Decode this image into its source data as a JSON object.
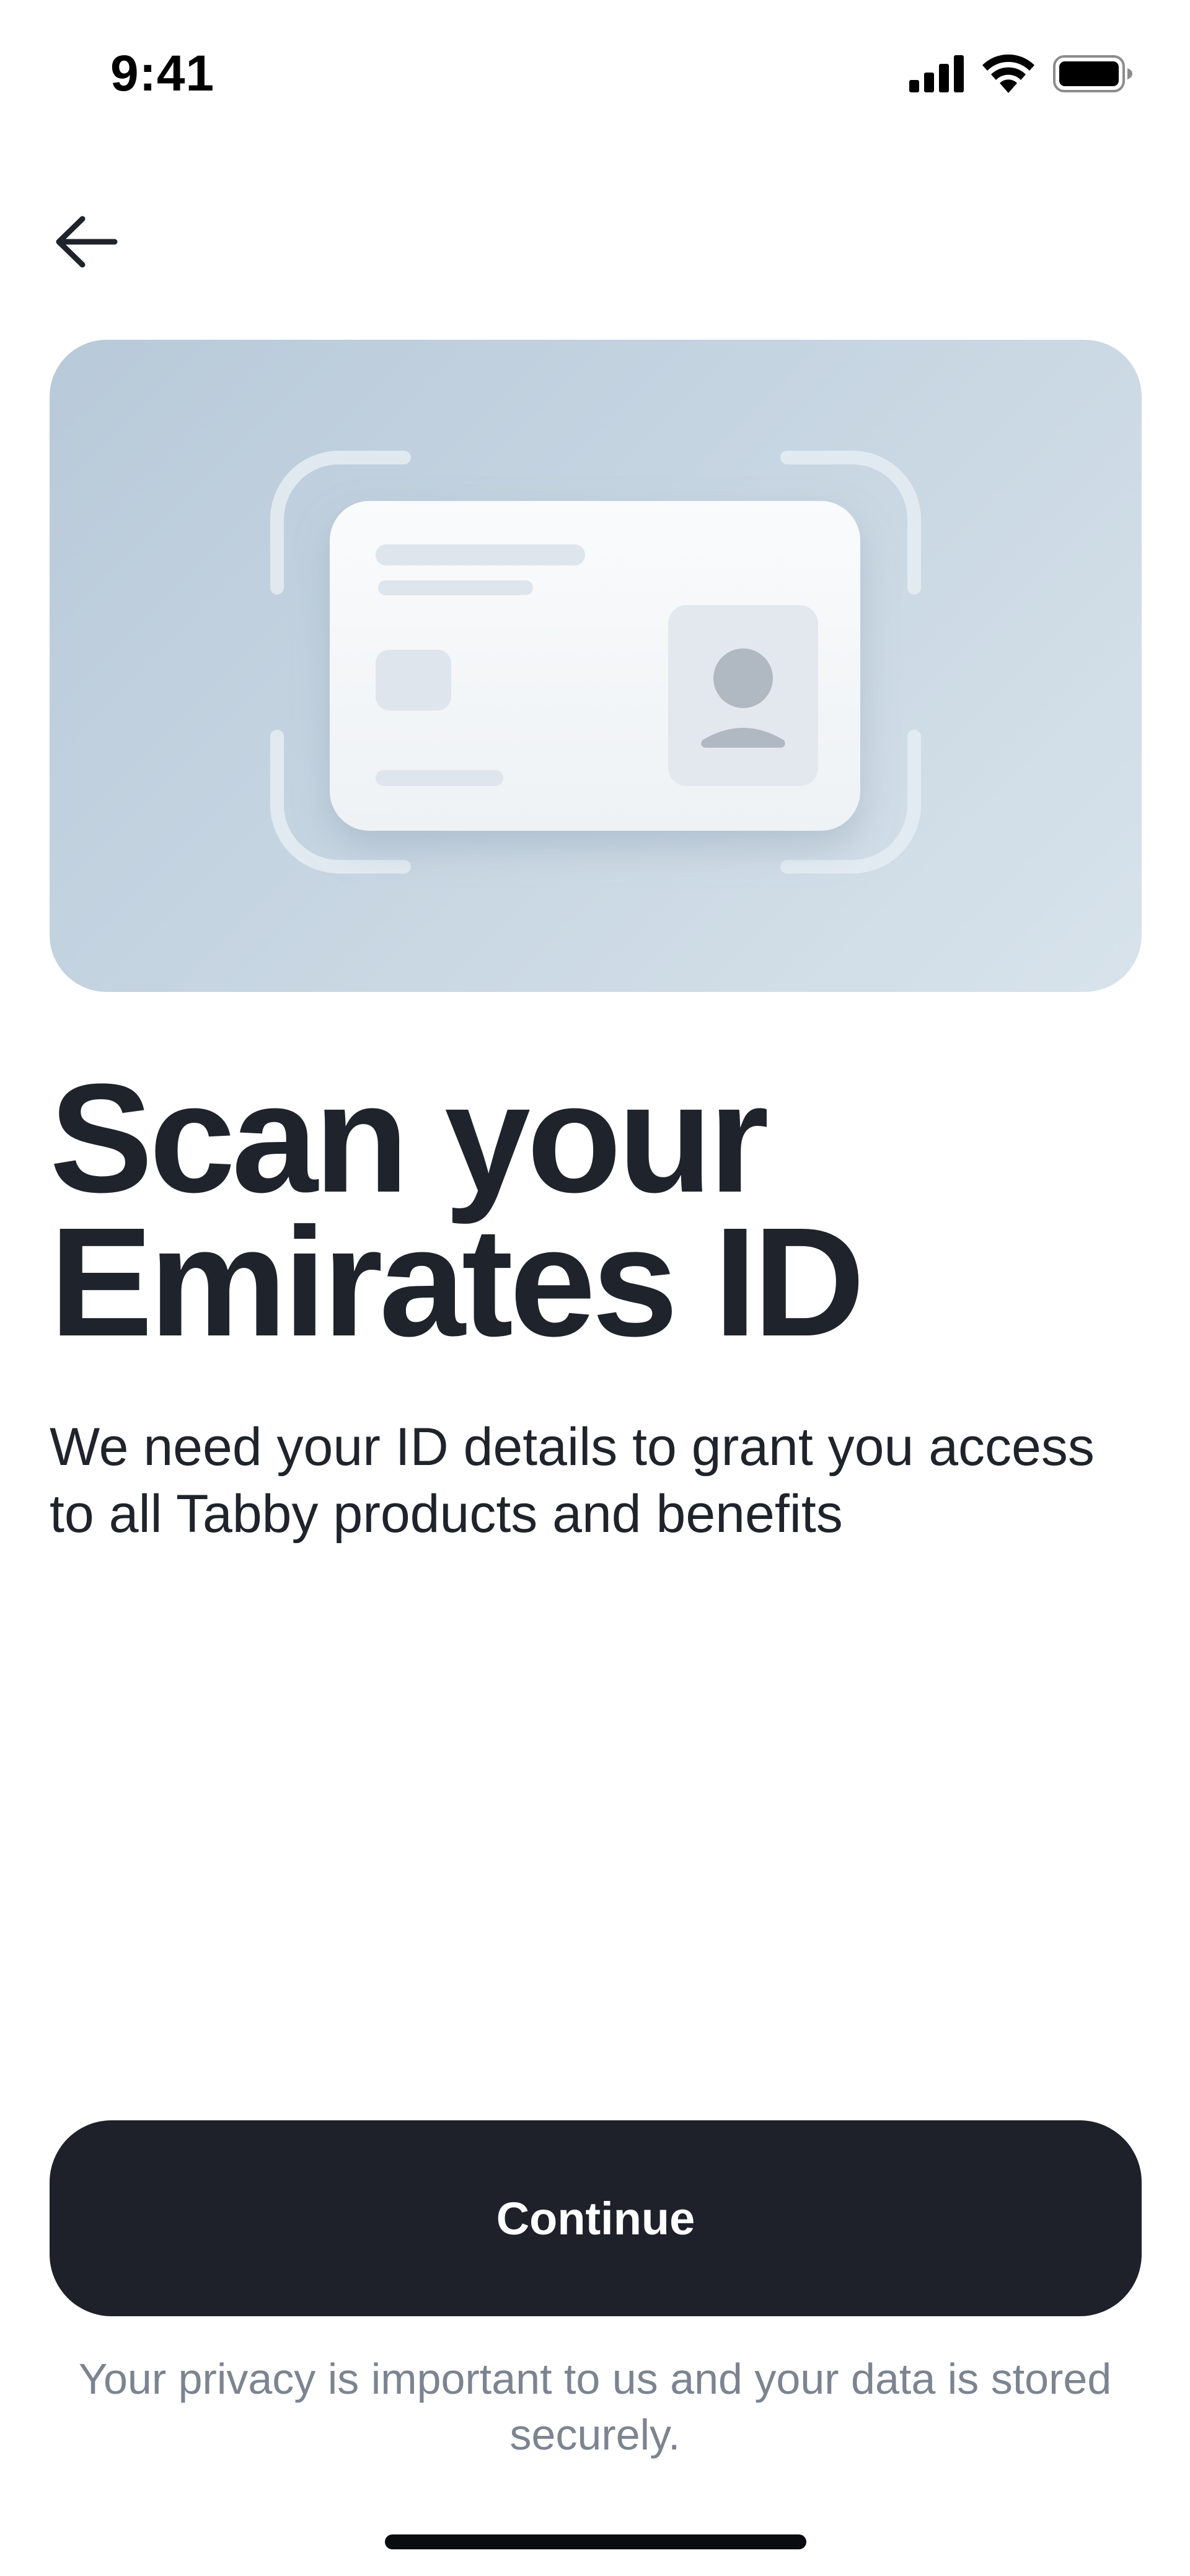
{
  "status_bar": {
    "time": "9:41",
    "icons": [
      "cellular-signal-icon",
      "wifi-icon",
      "battery-icon"
    ]
  },
  "navigation": {
    "back_icon": "arrow-left-icon"
  },
  "hero": {
    "illustration": "id-card-scan-illustration",
    "colors": {
      "background_start": "#b8c9d9",
      "background_end": "#d8e3eb",
      "card": "#f4f6f8"
    }
  },
  "content": {
    "title": "Scan your Emirates ID",
    "description": "We need your ID details to grant you access to all Tabby products and benefits"
  },
  "actions": {
    "continue_label": "Continue"
  },
  "footer": {
    "privacy_note": "Your privacy is important to us and your data is stored securely."
  },
  "colors": {
    "primary_button": "#1e2129",
    "text_primary": "#1f232b",
    "text_muted": "#7c8491"
  }
}
